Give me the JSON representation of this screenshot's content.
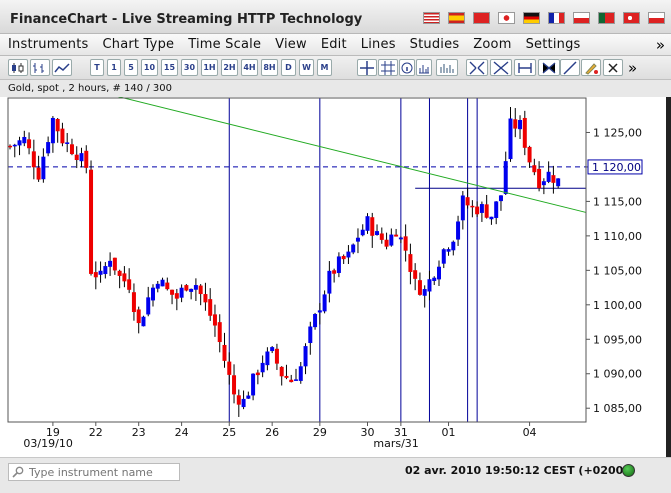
{
  "window": {
    "title": "FinanceChart - Live Streaming HTTP Technology"
  },
  "languages": [
    "us-flag-icon",
    "es-flag-icon",
    "cn-flag-icon",
    "jp-flag-icon",
    "de-flag-icon",
    "fr-flag-icon",
    "pl-flag-icon",
    "pt-flag-icon",
    "tr-flag-icon",
    "cz-flag-icon"
  ],
  "menu": {
    "items": [
      "Instruments",
      "Chart Type",
      "Time Scale",
      "View",
      "Edit",
      "Lines",
      "Studies",
      "Zoom",
      "Settings"
    ],
    "more": "»"
  },
  "toolbar": {
    "timescales": [
      "T",
      "1",
      "5",
      "10",
      "15",
      "30",
      "1H",
      "2H",
      "4H",
      "8H",
      "D",
      "W",
      "M"
    ],
    "more": "»"
  },
  "chart": {
    "info": "Gold, spot , 2 hours, # 140 / 300",
    "current_price_label": "1 120,00"
  },
  "chart_data": {
    "type": "candlestick",
    "instrument": "Gold, spot",
    "interval": "2 hours",
    "y_ticks": [
      "1 085,00",
      "1 090,00",
      "1 095,00",
      "1 100,00",
      "1 105,00",
      "1 110,00",
      "1 115,00",
      "1 120,00",
      "1 125,00"
    ],
    "ylim": [
      1083,
      1130
    ],
    "x_ticks": [
      "19",
      "22",
      "23",
      "24",
      "25",
      "26",
      "29",
      "30",
      "31",
      "01",
      "04"
    ],
    "x_sublabels": [
      "03/19/10",
      "mars/31"
    ],
    "current_price": 1120.0,
    "horizontal_line": 1116.9,
    "trendline": {
      "from": [
        0,
        1130.5
      ],
      "to": [
        100,
        1113.4
      ]
    },
    "vertical_lines_at_tick": [
      "25",
      "29",
      "31",
      "01"
    ],
    "colors": {
      "up": "#0000ee",
      "down": "#ee0000",
      "trendline": "#22aa22",
      "price_line": "#0000aa",
      "vlines": "#000099"
    },
    "close_path": [
      [
        0,
        1123
      ],
      [
        3,
        1124
      ],
      [
        6,
        1119
      ],
      [
        9,
        1127
      ],
      [
        11,
        1124
      ],
      [
        14,
        1122
      ],
      [
        16,
        1120
      ],
      [
        17,
        1105
      ],
      [
        19,
        1104
      ],
      [
        21,
        1107
      ],
      [
        23,
        1104
      ],
      [
        25,
        1103
      ],
      [
        27,
        1097
      ],
      [
        29,
        1101
      ],
      [
        31,
        1104
      ],
      [
        33,
        1102
      ],
      [
        35,
        1101
      ],
      [
        37,
        1103
      ],
      [
        39,
        1103
      ],
      [
        41,
        1100
      ],
      [
        43,
        1097
      ],
      [
        45,
        1092
      ],
      [
        47,
        1087
      ],
      [
        49,
        1086
      ],
      [
        51,
        1089
      ],
      [
        53,
        1092
      ],
      [
        55,
        1093
      ],
      [
        57,
        1090
      ],
      [
        59,
        1089
      ],
      [
        61,
        1091
      ],
      [
        63,
        1096
      ],
      [
        65,
        1100
      ],
      [
        67,
        1104
      ],
      [
        69,
        1106
      ],
      [
        71,
        1107
      ],
      [
        73,
        1110
      ],
      [
        75,
        1112
      ],
      [
        77,
        1110
      ],
      [
        79,
        1109
      ],
      [
        81,
        1111
      ],
      [
        83,
        1108
      ],
      [
        85,
        1103
      ],
      [
        87,
        1102
      ],
      [
        89,
        1105
      ],
      [
        91,
        1108
      ],
      [
        93,
        1110
      ],
      [
        95,
        1115
      ],
      [
        97,
        1114
      ],
      [
        99,
        1114
      ],
      [
        101,
        1113
      ],
      [
        103,
        1116
      ],
      [
        105,
        1126
      ],
      [
        107,
        1126
      ],
      [
        109,
        1121
      ],
      [
        111,
        1118
      ],
      [
        113,
        1119
      ],
      [
        115,
        1118
      ]
    ]
  },
  "status": {
    "search_placeholder": "Type instrument name",
    "datetime": "02 avr. 2010 19:50:12  CEST (+0200)"
  }
}
